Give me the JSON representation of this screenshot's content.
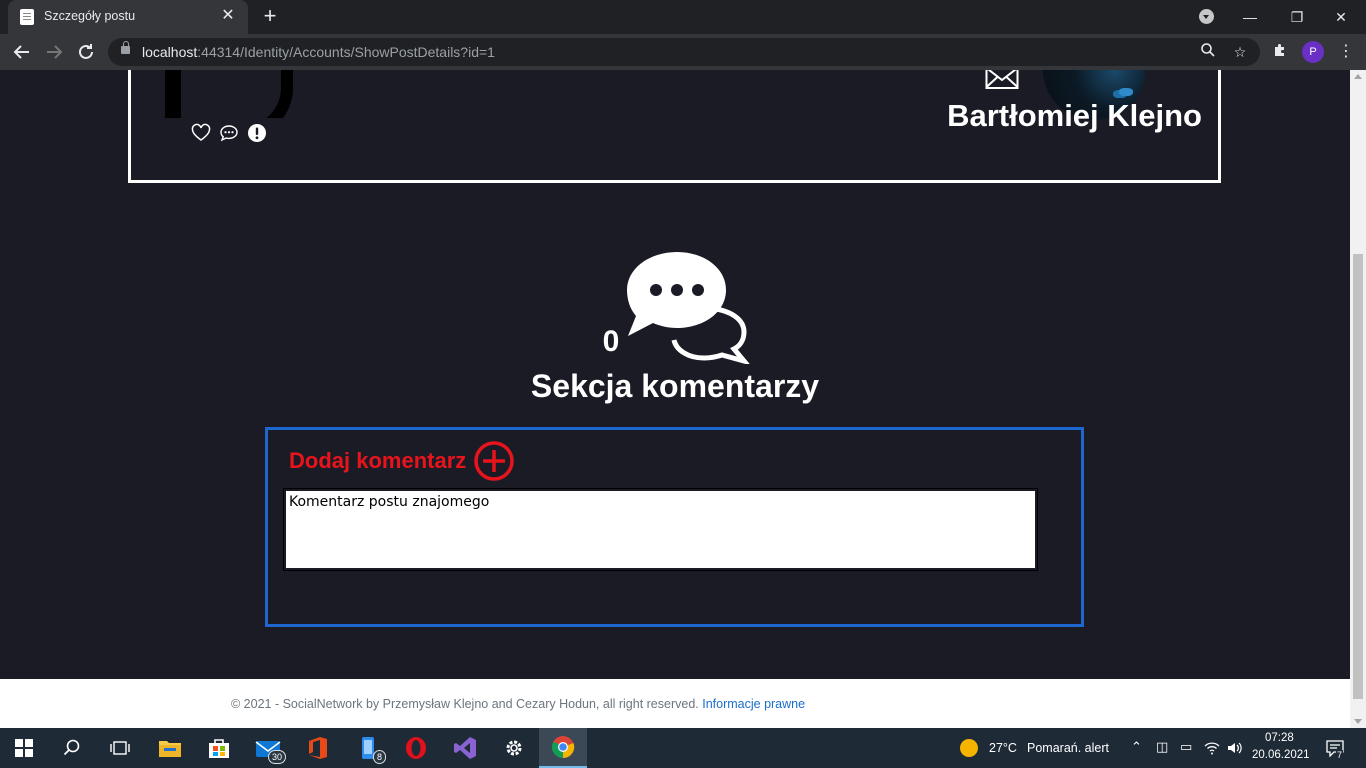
{
  "browser": {
    "tab_title": "Szczegóły postu",
    "tab_close": "✕",
    "new_tab": "+",
    "url_host": "localhost",
    "url_rest": ":44314/Identity/Accounts/ShowPostDetails?id=1",
    "profile_initial": "P",
    "window_minimize": "—",
    "window_restore": "❐",
    "window_close": "✕"
  },
  "post": {
    "author_name": "Bartłomiej Klejno"
  },
  "comments": {
    "count": "0",
    "section_title": "Sekcja komentarzy",
    "add_title": "Dodaj komentarz",
    "input_value": "Komentarz postu znajomego"
  },
  "footer": {
    "copyright": "© 2021 - SocialNetwork by Przemysław Klejno and Cezary Hodun, all right reserved.",
    "legal_link": "Informacje prawne"
  },
  "taskbar": {
    "mail_badge": "30",
    "phone_badge": "8",
    "weather": "27°C",
    "weather_alert": "Pomarań. alert",
    "time": "07:28",
    "date": "20.06.2021",
    "notifications": "7"
  },
  "colors": {
    "page_background": "#1b1b26",
    "accent_red": "#e8141c",
    "accent_blue": "#1e66d0",
    "link_blue": "#1a6ecb"
  }
}
